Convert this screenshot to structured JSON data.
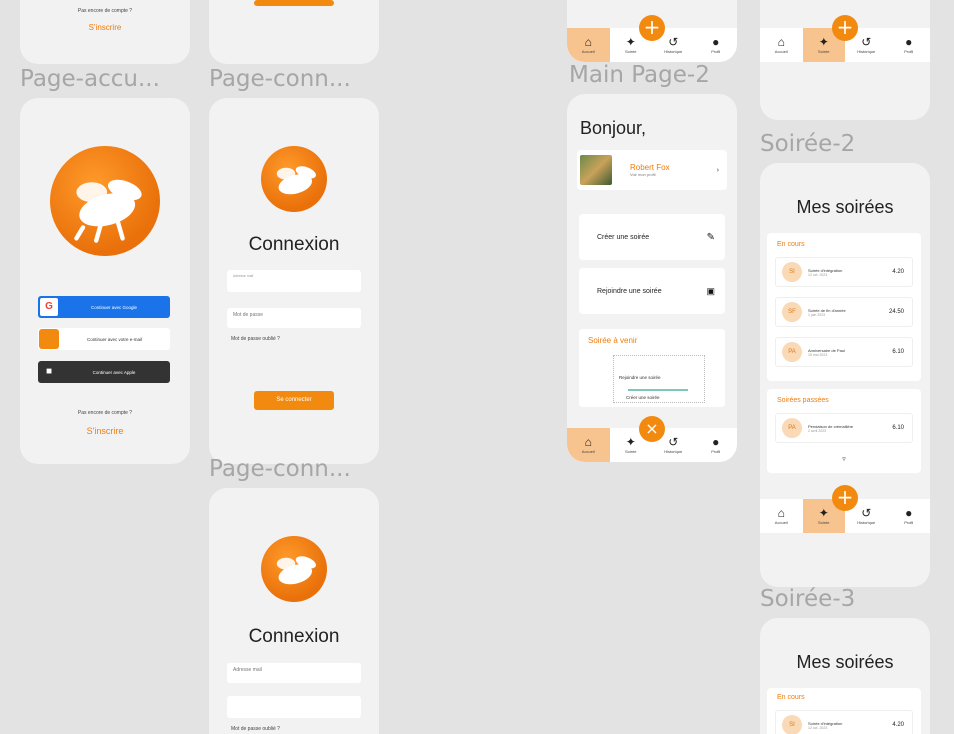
{
  "labels": {
    "accueil": "Page-accu...",
    "connexion1": "Page-conn...",
    "connexion2": "Page-conn...",
    "main2": "Main Page-2",
    "soiree2": "Soirée-2",
    "soiree3": "Soirée-3"
  },
  "top_stub": {
    "question": "Pas encore de compte ?",
    "register": "S'inscrire"
  },
  "accueil": {
    "google": "Continuer avec Google",
    "app": "Continuer avec votre e-mail",
    "apple": "Continuer avec Apple",
    "question": "Pas encore de compte ?",
    "register": "S'inscrire"
  },
  "connexion": {
    "title": "Connexion",
    "email_label": "Adresse mail",
    "email_placeholder": "Adresse mail",
    "password_placeholder": "Mot de passe",
    "forgot": "Mot de passe oublié ?",
    "submit": "Se connecter"
  },
  "main": {
    "greeting": "Bonjour,",
    "user_name": "Robert Fox",
    "user_sub": "Voir mon profil",
    "create": "Créer une soirée",
    "join": "Rejoindre une soirée",
    "tonight_title": "Soirée à venir",
    "menu_join": "Rejoindre une soirée",
    "menu_create": "Créer une soirée"
  },
  "nav": {
    "home": "Accueil",
    "party": "Soirée",
    "history": "Historique",
    "profile": "Profil"
  },
  "soirees": {
    "title": "Mes soirées",
    "current_section": "En cours",
    "past_section": "Soirées passées",
    "current": [
      {
        "initials": "SI",
        "name": "Soirée d'intégration",
        "date": "12 oct. 2023",
        "score": "4.20"
      },
      {
        "initials": "SF",
        "name": "Soirée de fin d'année",
        "date": "1 juin 2023",
        "score": "24.50"
      },
      {
        "initials": "PA",
        "name": "Anniversaire de Paul",
        "date": "15 mai 2023",
        "score": "6.10"
      }
    ],
    "past": [
      {
        "initials": "PA",
        "name": "Pendaison de crémaillère",
        "date": "2 avril 2023",
        "score": "6.10"
      }
    ]
  }
}
